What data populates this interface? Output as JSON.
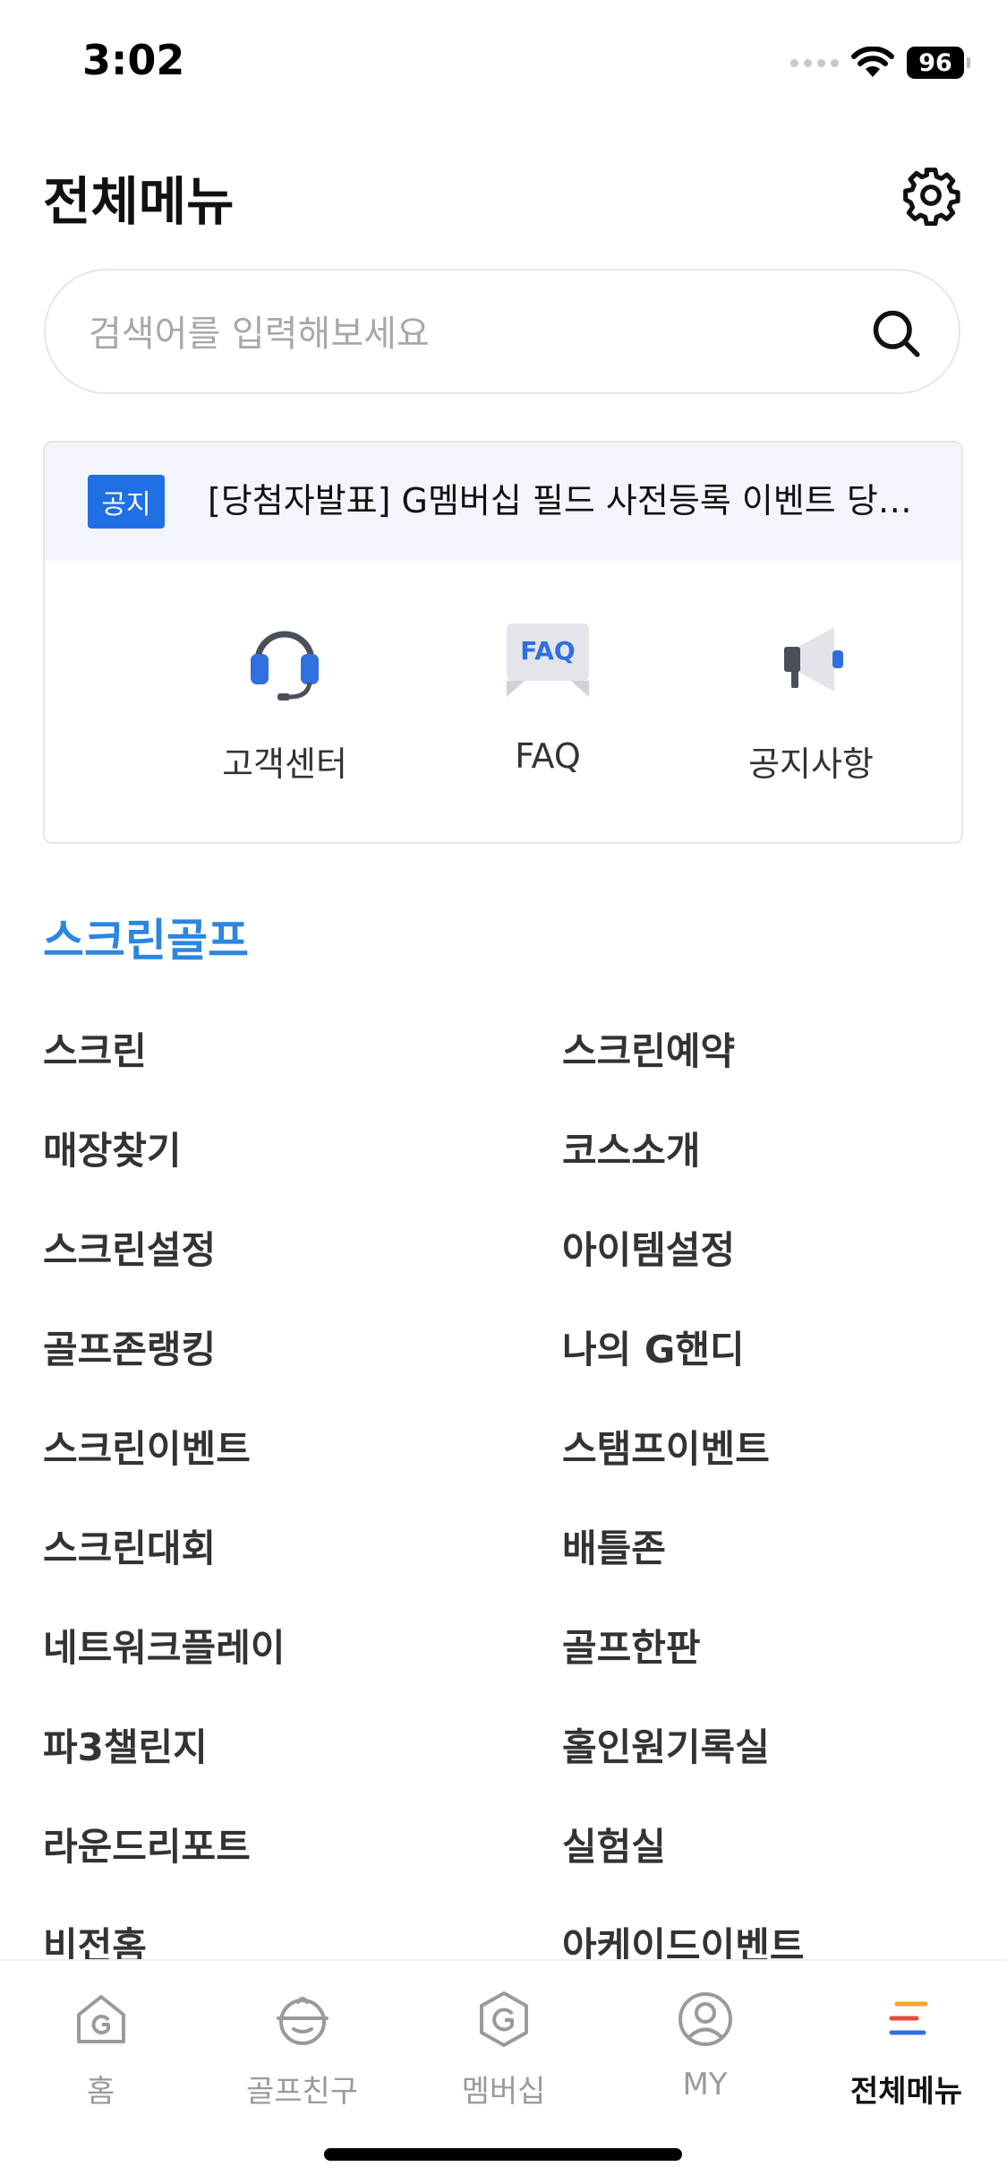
{
  "status": {
    "time": "3:02",
    "battery": "96"
  },
  "header": {
    "title": "전체메뉴"
  },
  "search": {
    "placeholder": "검색어를 입력해보세요"
  },
  "notice": {
    "badge": "공지",
    "text": "[당첨자발표] G멤버십 필드 사전등록 이벤트 당첨자 발표"
  },
  "quick_links": [
    {
      "label": "고객센터",
      "icon": "headset-icon"
    },
    {
      "label": "FAQ",
      "icon": "faq-icon"
    },
    {
      "label": "공지사항",
      "icon": "megaphone-icon"
    }
  ],
  "section": {
    "title": "스크린골프"
  },
  "menu": {
    "left": [
      "스크린",
      "매장찾기",
      "스크린설정",
      "골프존랭킹",
      "스크린이벤트",
      "스크린대회",
      "네트워크플레이",
      "파3챌린지",
      "라운드리포트",
      "비전홈"
    ],
    "right": [
      "스크린예약",
      "코스소개",
      "아이템설정",
      "나의 G핸디",
      "스탬프이벤트",
      "배틀존",
      "골프한판",
      "홀인원기록실",
      "실험실",
      "아케이드이벤트"
    ]
  },
  "nav": [
    {
      "label": "홈",
      "icon": "home-icon"
    },
    {
      "label": "골프친구",
      "icon": "golf-friend-icon"
    },
    {
      "label": "멤버십",
      "icon": "membership-icon"
    },
    {
      "label": "MY",
      "icon": "profile-icon"
    },
    {
      "label": "전체메뉴",
      "icon": "menu-icon"
    }
  ],
  "nav_active_index": 4,
  "faq_icon_text": "FAQ",
  "colors": {
    "accent": "#2a86e0",
    "badge": "#1f6fe5",
    "notice_bg": "#f2f6fc"
  }
}
